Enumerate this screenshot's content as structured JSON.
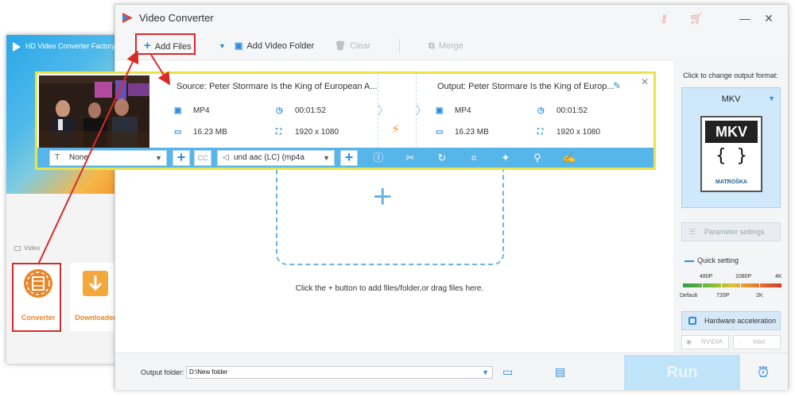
{
  "back_window": {
    "title": "HD Video Converter Factory",
    "section_label": "Video",
    "tiles": [
      {
        "label": "Converter"
      },
      {
        "label": "Downloader"
      }
    ]
  },
  "main_window": {
    "title": "Video Converter",
    "title_icons": [
      "key-icon",
      "cart-icon"
    ],
    "window_controls": {
      "minimize": "—",
      "close": "✕"
    },
    "toolbar": {
      "add_files": "Add Files",
      "add_video_folder": "Add Video Folder",
      "clear": "Clear",
      "merge": "Merge"
    },
    "drop_hint": "Click the + button to add files/folder,or drag files here.",
    "right_panel": {
      "title": "Click to change output format:",
      "format_name": "MKV",
      "format_badge": "MKV",
      "format_badge_brand": "MATROŠKA",
      "parameter_settings": "Parameter settings",
      "quick_setting": "Quick setting",
      "resolutions_top": [
        "480P",
        "1080P",
        "4K"
      ],
      "resolutions_bottom": [
        "Default",
        "720P",
        "2K"
      ],
      "hardware_acceleration": "Hardware acceleration",
      "gpu_options": [
        "NVIDIA",
        "Intel"
      ]
    },
    "bottom_bar": {
      "output_folder_label": "Output folder:",
      "output_folder_value": "D:\\New folder",
      "run_label": "Run"
    }
  },
  "task": {
    "source": "Source: Peter Stormare Is the King of European A...",
    "output": "Output: Peter Stormare Is the King of Europ...",
    "source_info": {
      "format": "MP4",
      "duration": "00:01:52",
      "size": "16.23 MB",
      "resolution": "1920 x 1080"
    },
    "output_info": {
      "format": "MP4",
      "duration": "00:01:52",
      "size": "16.23 MB",
      "resolution": "1920 x 1080"
    },
    "subtitle_select": "None",
    "audio_select": "und aac (LC) (mp4a"
  }
}
